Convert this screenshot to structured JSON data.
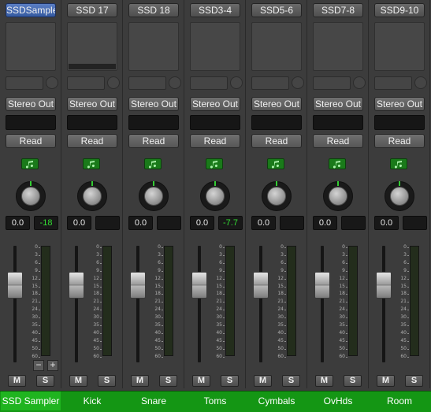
{
  "strips": [
    {
      "slot": "SSDSampler",
      "output": "Stereo Out",
      "automation": "Read",
      "volume": "0.0",
      "peak": "-18",
      "name": "SSD Sampler",
      "fader_level": 0.71,
      "active": true,
      "plugin_active": false
    },
    {
      "slot": "SSD 17",
      "output": "Stereo Out",
      "automation": "Read",
      "volume": "0.0",
      "peak": "",
      "name": "Kick",
      "fader_level": 0.71,
      "active": false,
      "plugin_active": true
    },
    {
      "slot": "SSD 18",
      "output": "Stereo Out",
      "automation": "Read",
      "volume": "0.0",
      "peak": "",
      "name": "Snare",
      "fader_level": 0.71,
      "active": false,
      "plugin_active": false
    },
    {
      "slot": "SSD3-4",
      "output": "Stereo Out",
      "automation": "Read",
      "volume": "0.0",
      "peak": "-7.7",
      "name": "Toms",
      "fader_level": 0.71,
      "active": false,
      "plugin_active": false
    },
    {
      "slot": "SSD5-6",
      "output": "Stereo Out",
      "automation": "Read",
      "volume": "0.0",
      "peak": "",
      "name": "Cymbals",
      "fader_level": 0.71,
      "active": false,
      "plugin_active": false
    },
    {
      "slot": "SSD7-8",
      "output": "Stereo Out",
      "automation": "Read",
      "volume": "0.0",
      "peak": "",
      "name": "OvHds",
      "fader_level": 0.71,
      "active": false,
      "plugin_active": false
    },
    {
      "slot": "SSD9-10",
      "output": "Stereo Out",
      "automation": "Read",
      "volume": "0.0",
      "peak": "",
      "name": "Room",
      "fader_level": 0.71,
      "active": false,
      "plugin_active": false
    }
  ],
  "fader_scale": [
    "0",
    "3",
    "6",
    "9",
    "12",
    "15",
    "18",
    "21",
    "24",
    "30",
    "35",
    "40",
    "45",
    "50",
    "60"
  ],
  "mute_label": "M",
  "solo_label": "S",
  "zoom_out_label": "−",
  "zoom_in_label": "+",
  "colors": {
    "name_bar": "#149614",
    "selected_slot": "#355aa0",
    "peak_text": "#33dd33",
    "midi_button": "#1a7a1a"
  },
  "icons": {
    "midi": "music-note-icon",
    "pan": "pan-knob-icon"
  }
}
